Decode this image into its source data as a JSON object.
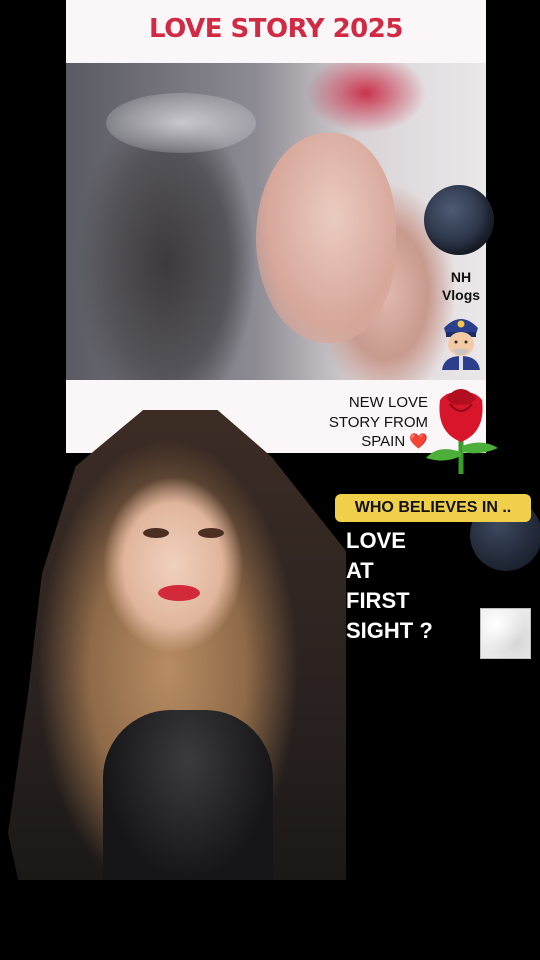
{
  "header": {
    "title": "LOVE STORY 2025"
  },
  "video": {
    "description_icon": "video-still"
  },
  "channel": {
    "name_line1": "NH",
    "name_line2": "Vlogs",
    "badge_icon": "police-officer-icon"
  },
  "caption": {
    "line1": "NEW LOVE",
    "line2": "STORY FROM",
    "line3": "SPAIN ❤️",
    "decor_icon": "rose-icon"
  },
  "question": {
    "badge": "WHO BELIEVES IN ..",
    "lines": [
      "LOVE",
      "AT",
      "FIRST",
      "SIGHT ?"
    ]
  },
  "colors": {
    "title_red": "#d12a44",
    "badge_yellow": "#f0cf4a",
    "background": "#000000",
    "card": "#fbf7f8"
  }
}
